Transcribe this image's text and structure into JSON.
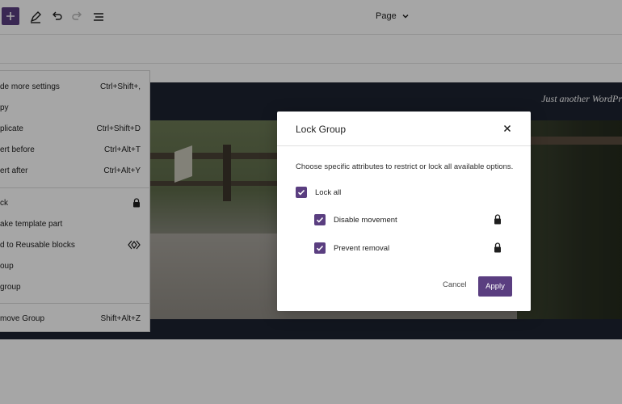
{
  "toolbar": {
    "document_title": "Page"
  },
  "site": {
    "tagline": "Just another WordPr"
  },
  "block_menu": {
    "items": [
      {
        "label": "de more settings",
        "shortcut": "Ctrl+Shift+,"
      },
      {
        "label": "py",
        "shortcut": ""
      },
      {
        "label": "plicate",
        "shortcut": "Ctrl+Shift+D"
      },
      {
        "label": "ert before",
        "shortcut": "Ctrl+Alt+T"
      },
      {
        "label": "ert after",
        "shortcut": "Ctrl+Alt+Y"
      },
      {
        "label": "ck",
        "shortcut": ""
      },
      {
        "label": "ake template part",
        "shortcut": ""
      },
      {
        "label": "d to Reusable blocks",
        "shortcut": ""
      },
      {
        "label": "oup",
        "shortcut": ""
      },
      {
        "label": "group",
        "shortcut": ""
      },
      {
        "label": "move Group",
        "shortcut": "Shift+Alt+Z"
      }
    ]
  },
  "lock_modal": {
    "title": "Lock Group",
    "description": "Choose specific attributes to restrict or lock all available options.",
    "options": [
      {
        "label": "Lock all",
        "checked": true
      },
      {
        "label": "Disable movement",
        "checked": true
      },
      {
        "label": "Prevent removal",
        "checked": true
      }
    ],
    "cancel_label": "Cancel",
    "apply_label": "Apply"
  },
  "colors": {
    "accent": "#5a3e80",
    "header_background": "#1c2231"
  }
}
